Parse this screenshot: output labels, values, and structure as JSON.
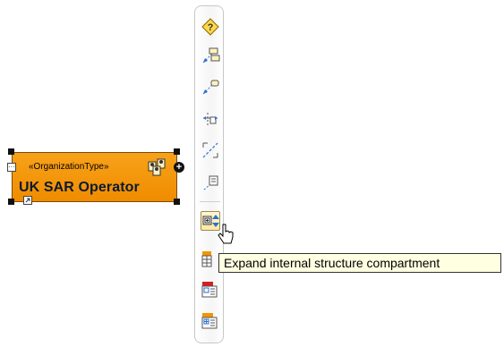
{
  "element": {
    "stereotype": "«OrganizationType»",
    "name": "UK SAR Operator",
    "collapse_glyph": "···",
    "plus_glyph": "+",
    "fill_color": "#f29600"
  },
  "toolbar": {
    "buttons": [
      {
        "icon": "diamond-question-icon",
        "state": "normal"
      },
      {
        "icon": "dependency-link-icon",
        "state": "normal"
      },
      {
        "icon": "association-link-icon",
        "state": "normal"
      },
      {
        "icon": "connector-link-icon",
        "state": "normal"
      },
      {
        "icon": "dashed-line-icon",
        "state": "normal"
      },
      {
        "icon": "note-link-icon",
        "state": "normal"
      },
      {
        "icon": "expand-structure-compartment-icon",
        "state": "hovered"
      },
      {
        "icon": "table-compartment-icon",
        "state": "normal"
      },
      {
        "icon": "red-table-compartment-icon",
        "state": "normal"
      },
      {
        "icon": "grid-compartment-icon",
        "state": "normal"
      }
    ]
  },
  "tooltip": {
    "text": "Expand internal structure compartment"
  }
}
